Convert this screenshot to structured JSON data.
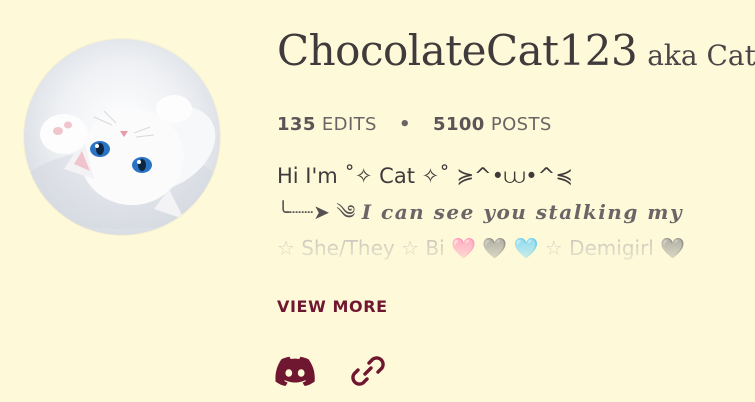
{
  "profile": {
    "username": "ChocolateCat123",
    "aka": "aka Cat",
    "avatar_icon": "white-kitten-avatar"
  },
  "stats": {
    "edits_count": "135",
    "edits_label": "EDITS",
    "separator": "•",
    "posts_count": "5100",
    "posts_label": "POSTS"
  },
  "bio": {
    "line1": "Hi I'm ˚✧ Cat ✧˚ ≽^•⩊•^≼",
    "line2_prefix": "╰┈┈➤ ༄",
    "line2_italic": "I can see you stalking my",
    "line3": "☆ She/They ☆ Bi 🩷 🩶 🩵 ☆ Demigirl 🩶"
  },
  "actions": {
    "view_more_label": "VIEW MORE"
  },
  "social": {
    "discord_icon": "discord-icon",
    "link_icon": "link-icon"
  },
  "colors": {
    "background": "#fef9d8",
    "accent": "#6f1731",
    "text": "#3f3a3b"
  }
}
